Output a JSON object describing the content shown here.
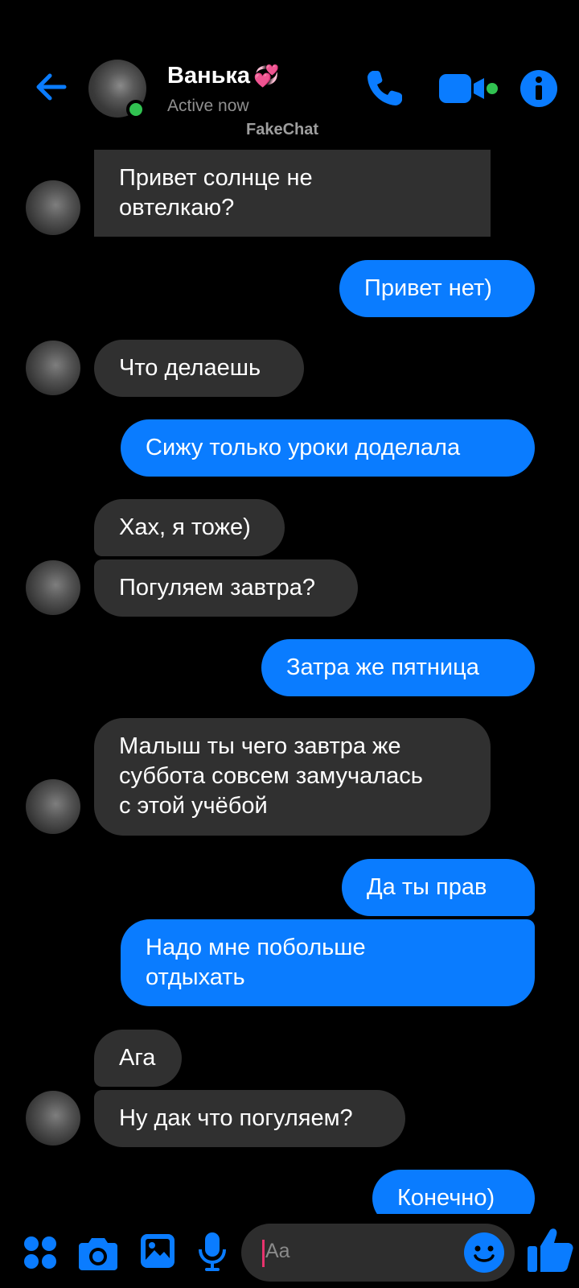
{
  "header": {
    "contact_name": "Ванька",
    "name_emoji": "💞",
    "status": "Active now",
    "watermark": "FakeChat"
  },
  "messages": [
    {
      "from": "contact",
      "lines": [
        "Привет солнце не",
        "овтелкаю?"
      ]
    },
    {
      "from": "me",
      "lines": [
        "Привет нет)"
      ]
    },
    {
      "from": "contact",
      "lines": [
        "Что делаешь"
      ]
    },
    {
      "from": "me",
      "lines": [
        "Сижу только уроки доделала"
      ]
    },
    {
      "from": "contact",
      "lines": [
        "Хах, я тоже)"
      ]
    },
    {
      "from": "contact",
      "lines": [
        "Погуляем завтра?"
      ]
    },
    {
      "from": "me",
      "lines": [
        "Затра же пятница"
      ]
    },
    {
      "from": "contact",
      "lines": [
        "Малыш ты чего завтра же",
        "суббота совсем замучалась",
        "с этой учёбой"
      ]
    },
    {
      "from": "me",
      "lines": [
        "Да ты прав"
      ]
    },
    {
      "from": "me",
      "lines": [
        "Надо мне побольше",
        "отдыхать"
      ]
    },
    {
      "from": "contact",
      "lines": [
        "Ага"
      ]
    },
    {
      "from": "contact",
      "lines": [
        "Ну дак что погуляем?"
      ]
    },
    {
      "from": "me",
      "lines": [
        "Конечно)"
      ]
    }
  ],
  "composer": {
    "placeholder": "Aa"
  },
  "colors": {
    "accent": "#0a7cff",
    "incoming_bubble": "#303030",
    "online": "#31c251",
    "background": "#000000"
  }
}
